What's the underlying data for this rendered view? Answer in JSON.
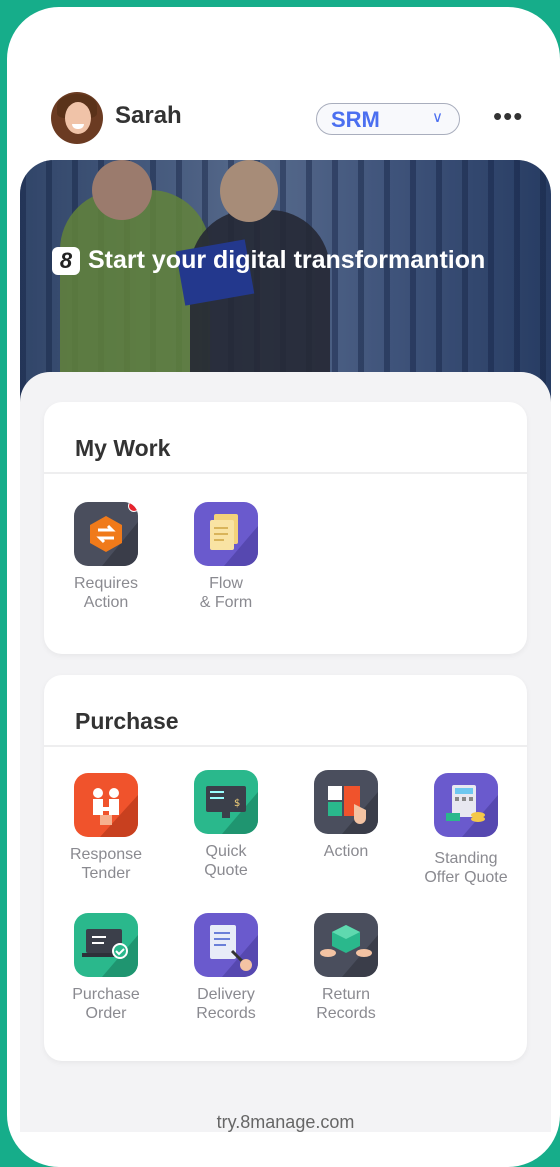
{
  "header": {
    "username": "Sarah",
    "module": "SRM",
    "more_label": "•••"
  },
  "banner": {
    "logo_text": "8",
    "title": "Start your digital transformantion"
  },
  "my_work": {
    "title": "My Work",
    "items": [
      {
        "label1": "Requires",
        "label2": "Action",
        "icon": "requires-action-icon",
        "color": "#4a4e5d",
        "badge": true
      },
      {
        "label1": "Flow",
        "label2": "& Form",
        "icon": "flow-form-icon",
        "color": "#6a5acd",
        "badge": false
      }
    ]
  },
  "purchase": {
    "title": "Purchase",
    "items": [
      {
        "label1": "Response",
        "label2": "Tender",
        "icon": "response-tender-icon",
        "color": "#f0532c"
      },
      {
        "label1": "Quick",
        "label2": "Quote",
        "icon": "quick-quote-icon",
        "color": "#2ab88c"
      },
      {
        "label1": "Action",
        "label2": "",
        "icon": "action-icon",
        "color": "#4a4e5d"
      },
      {
        "label1": "Standing",
        "label2": "Offer Quote",
        "icon": "standing-offer-quote-icon",
        "color": "#6a5acd"
      },
      {
        "label1": "Purchase",
        "label2": "Order",
        "icon": "purchase-order-icon",
        "color": "#2ab88c"
      },
      {
        "label1": "Delivery",
        "label2": "Records",
        "icon": "delivery-records-icon",
        "color": "#6a5acd"
      },
      {
        "label1": "Return",
        "label2": "Records",
        "icon": "return-records-icon",
        "color": "#4a4e5d"
      }
    ]
  },
  "footer": {
    "url": "try.8manage.com"
  }
}
